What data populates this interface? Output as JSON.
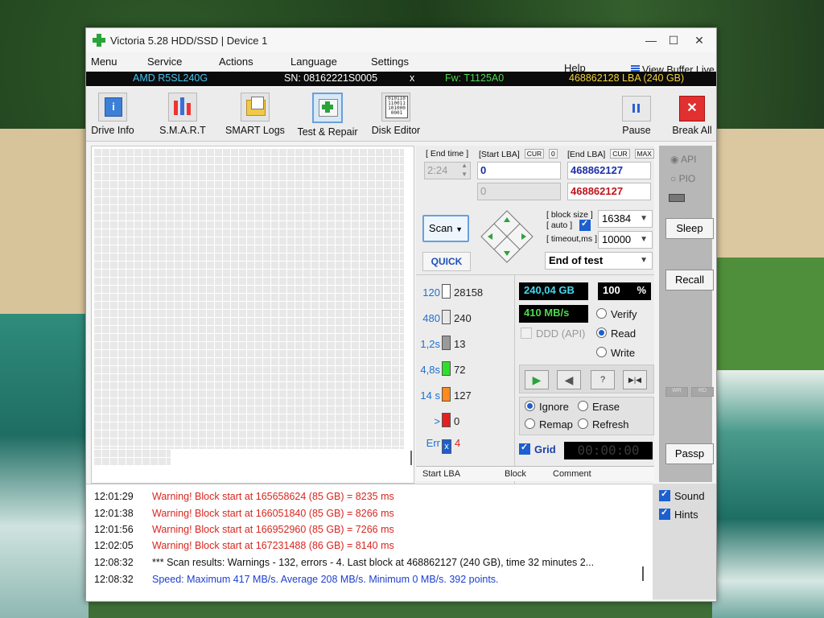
{
  "window": {
    "title": "Victoria 5.28 HDD/SSD | Device 1",
    "controls": {
      "minimize": "—",
      "maximize": "☐",
      "close": "✕"
    }
  },
  "menu": {
    "items": [
      "Menu",
      "Service",
      "Actions",
      "Language",
      "Settings",
      "Help"
    ],
    "view_buffer": "View Buffer Live"
  },
  "device_bar": {
    "model": "AMD R5SL240G",
    "serial": "SN: 08162221S0005",
    "close": "x",
    "firmware": "Fw: T1125A0",
    "capacity": "468862128 LBA (240 GB)",
    "colors": {
      "model": "#45c4f0",
      "serial": "#ffffff",
      "firmware": "#4ed84e",
      "capacity": "#f2d23c"
    }
  },
  "toolbar": {
    "buttons": [
      {
        "label": "Drive Info",
        "icon": "drive-info-icon"
      },
      {
        "label": "S.M.A.R.T",
        "icon": "smart-icon"
      },
      {
        "label": "SMART Logs",
        "icon": "smart-logs-icon"
      },
      {
        "label": "Test & Repair",
        "icon": "test-repair-icon",
        "active": true
      },
      {
        "label": "Disk Editor",
        "icon": "disk-editor-icon"
      }
    ],
    "pause": "Pause",
    "break_all": "Break All"
  },
  "test": {
    "end_time_label": "[ End time ]",
    "end_time": "2:24",
    "start_lba_label": "[Start LBA]",
    "start_chip_cur": "CUR",
    "start_chip_val": "0",
    "start_lba": "0",
    "start_lba_2": "0",
    "end_lba_label": "[End LBA]",
    "end_chip_cur": "CUR",
    "end_chip_max": "MAX",
    "end_lba": "468862127",
    "end_lba_2": "468862127",
    "scan_button": "Scan",
    "quick_button": "QUICK",
    "block_size_label": "[ block size ]",
    "auto_label": "[ auto ]",
    "block_size": "16384",
    "timeout_label": "[ timeout,ms ]",
    "timeout": "10000",
    "end_action": "End of test"
  },
  "stats": [
    {
      "label": "120",
      "count": "28158",
      "color": "#ffffff"
    },
    {
      "label": "480",
      "count": "240",
      "color": "#e8e8e8"
    },
    {
      "label": "1,2s",
      "count": "13",
      "color": "#9a9a9a"
    },
    {
      "label": "4,8s",
      "count": "72",
      "color": "#2ee02e"
    },
    {
      "label": "14 s",
      "count": "127",
      "color": "#ff8a1e"
    },
    {
      "label": ">",
      "count": "0",
      "color": "#e52020"
    },
    {
      "label": "Err",
      "count": "4",
      "color": "#1c5fd0"
    }
  ],
  "status": {
    "size": "240,04 GB",
    "percent": "100",
    "percent_unit": "%",
    "speed": "410 MB/s",
    "ddd_api": "DDD (API)"
  },
  "mode": {
    "verify": "Verify",
    "read": "Read",
    "write": "Write",
    "selected": "Read"
  },
  "playback": {
    "play": "▶",
    "back": "◀",
    "skip": "?",
    "end": "▶|◀"
  },
  "repair": {
    "ignore": "Ignore",
    "erase": "Erase",
    "remap": "Remap",
    "refresh": "Refresh",
    "selected": "Ignore"
  },
  "grid": {
    "label": "Grid",
    "timer": "00:00:00"
  },
  "columns": [
    "Start LBA",
    "Block",
    "Comment"
  ],
  "side": {
    "api": "API",
    "pio": "PIO",
    "sleep": "Sleep",
    "recall": "Recall",
    "passp": "Passp",
    "small_btn_1": "WR",
    "small_btn_2": "RD"
  },
  "log_options": {
    "sound": "Sound",
    "hints": "Hints"
  },
  "log": [
    {
      "time": "12:01:29",
      "text": "Warning! Block start at 165658624 (85 GB)  = 8235 ms",
      "color": "#d8261f"
    },
    {
      "time": "12:01:38",
      "text": "Warning! Block start at 166051840 (85 GB)  = 8266 ms",
      "color": "#d8261f"
    },
    {
      "time": "12:01:56",
      "text": "Warning! Block start at 166952960 (85 GB)  = 7266 ms",
      "color": "#d8261f"
    },
    {
      "time": "12:02:05",
      "text": "Warning! Block start at 167231488 (86 GB)  = 8140 ms",
      "color": "#d8261f"
    },
    {
      "time": "12:08:32",
      "text": "*** Scan results: Warnings - 132, errors - 4. Last block at 468862127 (240 GB), time 32 minutes 2...",
      "color": "#111111"
    },
    {
      "time": "12:08:32",
      "text": "Speed: Maximum 417 MB/s. Average 208 MB/s. Minimum 0 MB/s. 392 points.",
      "color": "#1c3fd0"
    }
  ]
}
